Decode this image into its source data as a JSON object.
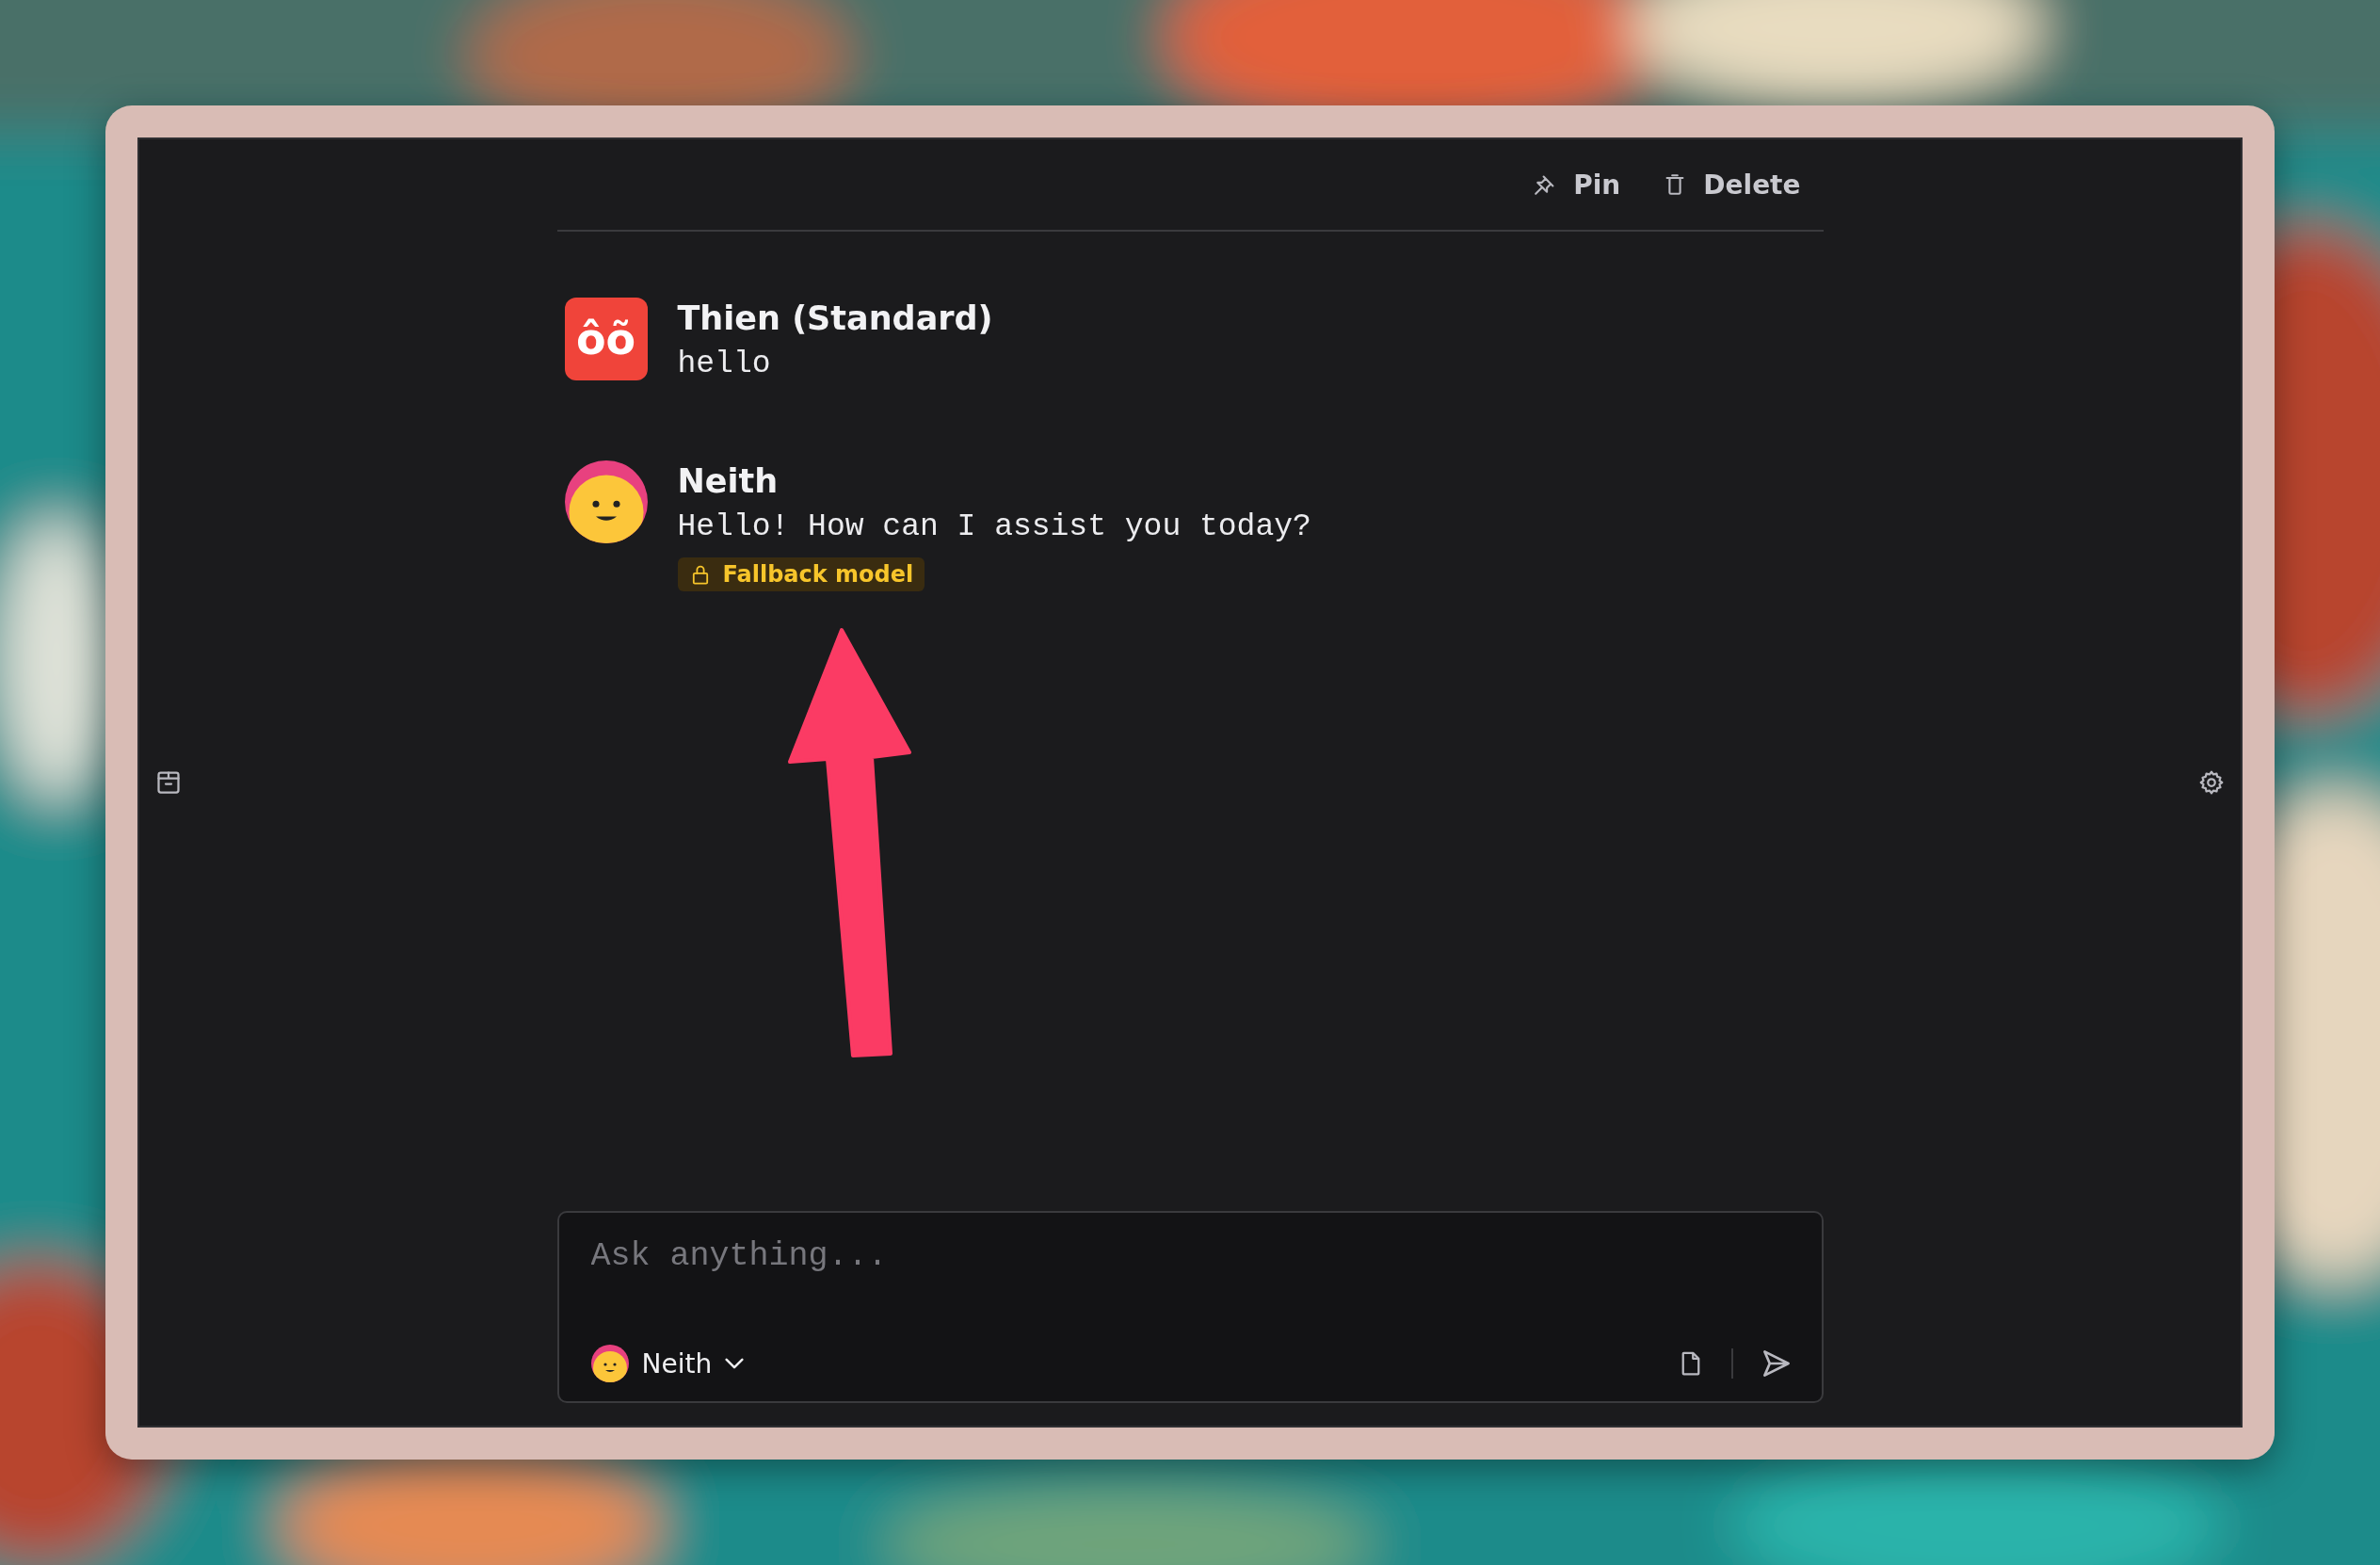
{
  "toolbar": {
    "buttons": [
      {
        "label": "Pin",
        "kind": "pin"
      },
      {
        "label": "Delete",
        "kind": "delete"
      }
    ]
  },
  "messages": [
    {
      "author": "Thien (Standard)",
      "text": "hello",
      "kind": "initials",
      "avatar_text": "ôõ"
    },
    {
      "author": "Neith",
      "text": "Hello! How can I assist you today?",
      "kind": "face",
      "badge": "Fallback model"
    }
  ],
  "composer": {
    "placeholder": "Ask anything...",
    "model": "Neith"
  }
}
